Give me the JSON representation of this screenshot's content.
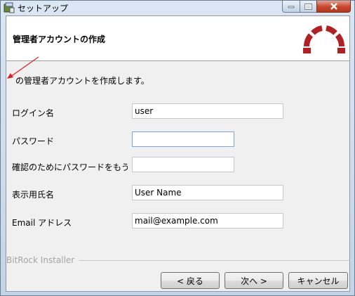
{
  "window": {
    "title": "セットアップ"
  },
  "header": {
    "title": "管理者アカウントの作成"
  },
  "description": "の管理者アカウントを作成します。",
  "form": {
    "login": {
      "label": "ログイン名",
      "value": "user"
    },
    "password": {
      "label": "パスワード",
      "value": ""
    },
    "confirm": {
      "label": "確認のためにパスワードをもう一度",
      "value": ""
    },
    "display_name": {
      "label": "表示用氏名",
      "value": "User Name"
    },
    "email": {
      "label": "Email アドレス",
      "value": "mail@example.com"
    }
  },
  "footer": {
    "installer_label": "BitRock Installer",
    "back_label": "< 戻る",
    "next_label": "次へ >",
    "cancel_label": "キャンセル"
  },
  "colors": {
    "logo": "#b32024",
    "arrow": "#e02020",
    "close_button": "#c8452b"
  },
  "icons": [
    "app-icon",
    "minimize-icon",
    "maximize-icon",
    "close-icon",
    "redmine-logo-icon",
    "red-arrow-annotation"
  ]
}
